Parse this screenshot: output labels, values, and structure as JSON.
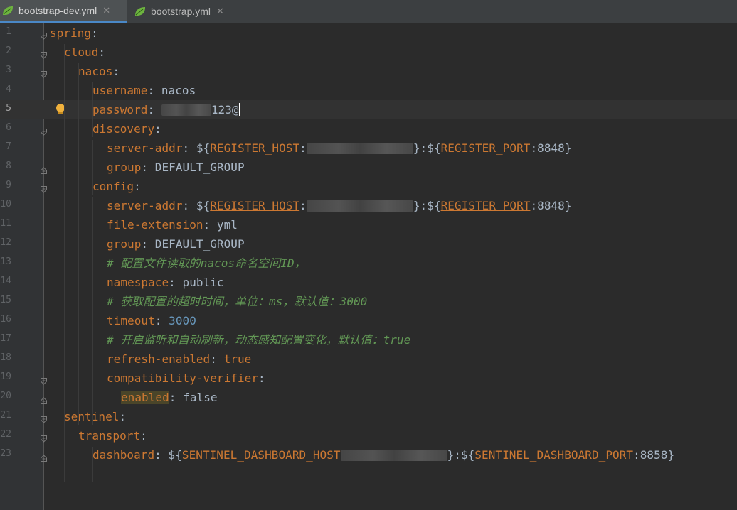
{
  "tabs": [
    {
      "label": "bootstrap-dev.yml",
      "active": true,
      "icon": "spring-leaf-icon"
    },
    {
      "label": "bootstrap.yml",
      "active": false,
      "icon": "spring-leaf-icon"
    }
  ],
  "close_glyph": "✕",
  "current_line": 5,
  "colors": {
    "keyword": "#cc7832",
    "string": "#a9b7c6",
    "number": "#6897bb",
    "comment": "#629755",
    "tab_accent": "#4a88c7"
  },
  "lines": [
    {
      "n": "1",
      "parts": [
        {
          "t": "spring",
          "cls": "k"
        },
        {
          "t": ":",
          "cls": "p"
        }
      ]
    },
    {
      "n": "2",
      "parts": [
        {
          "t": "cloud",
          "cls": "k"
        },
        {
          "t": ":",
          "cls": "p"
        }
      ]
    },
    {
      "n": "3",
      "parts": [
        {
          "t": "nacos",
          "cls": "k"
        },
        {
          "t": ":",
          "cls": "p"
        }
      ]
    },
    {
      "n": "4",
      "parts": [
        {
          "t": "username",
          "cls": "k"
        },
        {
          "t": ": nacos",
          "cls": "p"
        }
      ]
    },
    {
      "n": "5",
      "parts": [
        {
          "t": "password",
          "cls": "k"
        },
        {
          "t": ": ",
          "cls": "p"
        },
        {
          "t": "",
          "cls": "blur",
          "w": 70
        },
        {
          "t": "123@",
          "cls": "p"
        }
      ]
    },
    {
      "n": "6",
      "parts": [
        {
          "t": "discovery",
          "cls": "k"
        },
        {
          "t": ":",
          "cls": "p"
        }
      ]
    },
    {
      "n": "7",
      "parts": [
        {
          "t": "server-addr",
          "cls": "k"
        },
        {
          "t": ": ${",
          "cls": "p"
        },
        {
          "t": "REGISTER_HOST",
          "cls": "ref"
        },
        {
          "t": ":",
          "cls": "p"
        },
        {
          "t": "",
          "cls": "blur",
          "w": 150
        },
        {
          "t": "}:${",
          "cls": "p"
        },
        {
          "t": "REGISTER_PORT",
          "cls": "ref"
        },
        {
          "t": ":8848}",
          "cls": "p"
        }
      ]
    },
    {
      "n": "8",
      "parts": [
        {
          "t": "group",
          "cls": "k"
        },
        {
          "t": ": DEFAULT_GROUP",
          "cls": "p"
        }
      ]
    },
    {
      "n": "9",
      "parts": [
        {
          "t": "config",
          "cls": "k"
        },
        {
          "t": ":",
          "cls": "p"
        }
      ]
    },
    {
      "n": "10",
      "parts": [
        {
          "t": "server-addr",
          "cls": "k"
        },
        {
          "t": ": ${",
          "cls": "p"
        },
        {
          "t": "REGISTER_HOST",
          "cls": "ref"
        },
        {
          "t": ":",
          "cls": "p"
        },
        {
          "t": "",
          "cls": "blur",
          "w": 150
        },
        {
          "t": "}:${",
          "cls": "p"
        },
        {
          "t": "REGISTER_PORT",
          "cls": "ref"
        },
        {
          "t": ":8848}",
          "cls": "p"
        }
      ]
    },
    {
      "n": "11",
      "parts": [
        {
          "t": "file-extension",
          "cls": "k"
        },
        {
          "t": ": yml",
          "cls": "p"
        }
      ]
    },
    {
      "n": "12",
      "parts": [
        {
          "t": "group",
          "cls": "k"
        },
        {
          "t": ": DEFAULT_GROUP",
          "cls": "p"
        }
      ]
    },
    {
      "n": "13",
      "parts": [
        {
          "t": "# 配置文件读取的nacos命名空间ID，",
          "cls": "c"
        }
      ]
    },
    {
      "n": "14",
      "parts": [
        {
          "t": "namespace",
          "cls": "k"
        },
        {
          "t": ": public",
          "cls": "p"
        }
      ]
    },
    {
      "n": "15",
      "parts": [
        {
          "t": "# 获取配置的超时时间，单位：ms，默认值：3000",
          "cls": "c"
        }
      ]
    },
    {
      "n": "16",
      "parts": [
        {
          "t": "timeout",
          "cls": "k"
        },
        {
          "t": ": ",
          "cls": "p"
        },
        {
          "t": "3000",
          "cls": "n"
        }
      ]
    },
    {
      "n": "17",
      "parts": [
        {
          "t": "# 开启监听和自动刷新，动态感知配置变化，默认值：true",
          "cls": "c"
        }
      ]
    },
    {
      "n": "18",
      "parts": [
        {
          "t": "refresh-enabled",
          "cls": "k"
        },
        {
          "t": ": ",
          "cls": "p"
        },
        {
          "t": "true",
          "cls": "k"
        }
      ]
    },
    {
      "n": "19",
      "parts": [
        {
          "t": "compatibility-verifier",
          "cls": "k"
        },
        {
          "t": ":",
          "cls": "p"
        }
      ]
    },
    {
      "n": "20",
      "parts": [
        {
          "t": "enabled",
          "cls": "k hl"
        },
        {
          "t": ": false",
          "cls": "p"
        }
      ]
    },
    {
      "n": "21",
      "parts": [
        {
          "t": "sentinel",
          "cls": "k"
        },
        {
          "t": ":",
          "cls": "p"
        }
      ]
    },
    {
      "n": "22",
      "parts": [
        {
          "t": "transport",
          "cls": "k"
        },
        {
          "t": ":",
          "cls": "p"
        }
      ]
    },
    {
      "n": "23",
      "parts": [
        {
          "t": "dashboard",
          "cls": "k"
        },
        {
          "t": ": ${",
          "cls": "p"
        },
        {
          "t": "SENTINEL_DASHBOARD_HOST",
          "cls": "ref"
        },
        {
          "t": "",
          "cls": "blur",
          "w": 150
        },
        {
          "t": "}:${",
          "cls": "p"
        },
        {
          "t": "SENTINEL_DASHBOARD_PORT",
          "cls": "ref"
        },
        {
          "t": ":8858}",
          "cls": "p"
        }
      ]
    }
  ]
}
